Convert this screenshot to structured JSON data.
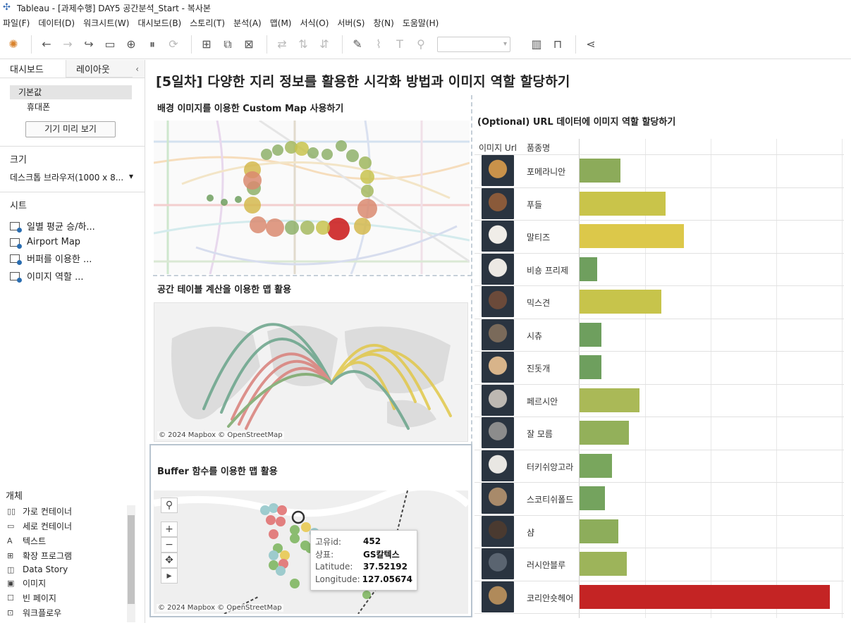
{
  "window": {
    "title": "Tableau - [과제수행] DAY5 공간분석_Start - 복사본"
  },
  "menu": [
    "파일(F)",
    "데이터(D)",
    "워크시트(W)",
    "대시보드(B)",
    "스토리(T)",
    "분석(A)",
    "맵(M)",
    "서식(O)",
    "서버(S)",
    "창(N)",
    "도움말(H)"
  ],
  "left": {
    "tab_dashboard": "대시보드",
    "tab_layout": "레이아웃",
    "device_default": "기본값",
    "device_phone": "휴대폰",
    "preview_button": "기기 미리 보기",
    "size_title": "크기",
    "size_value": "데스크톱 브라우저(1000 x 8...",
    "sheets_title": "시트",
    "sheets": [
      "일별 평균 승/하...",
      "Airport Map",
      "버퍼를 이용한 ...",
      "이미지 역할 ..."
    ],
    "objects_title": "개체",
    "objects": [
      {
        "icon": "horizontal-container-icon",
        "glyph": "▯▯",
        "label": "가로 컨테이너"
      },
      {
        "icon": "vertical-container-icon",
        "glyph": "▭",
        "label": "세로 컨테이너"
      },
      {
        "icon": "text-icon",
        "glyph": "A",
        "label": "텍스트"
      },
      {
        "icon": "extension-icon",
        "glyph": "⊞",
        "label": "확장 프로그램"
      },
      {
        "icon": "data-story-icon",
        "glyph": "◫",
        "label": "Data Story"
      },
      {
        "icon": "image-icon",
        "glyph": "▣",
        "label": "이미지"
      },
      {
        "icon": "blank-icon",
        "glyph": "☐",
        "label": "빈 페이지"
      },
      {
        "icon": "workflow-icon",
        "glyph": "⊡",
        "label": "워크플로우"
      }
    ]
  },
  "dashboard": {
    "title": "[5일차] 다양한 지리 정보를 활용한 시각화 방법과 이미지 역할 할당하기",
    "zone1_title": "배경 이미지를 이용한 Custom Map 사용하기",
    "zone2_title": "공간 테이블 계산을 이용한 맵 활용",
    "zone3_title": "Buffer 함수를 이용한 맵 활용",
    "zone4_title": "(Optional) URL 데이터에 이미지 역할 할당하기",
    "map_credit": "© 2024 Mapbox © OpenStreetMap",
    "tooltip": [
      {
        "k": "고유id:",
        "v": "452"
      },
      {
        "k": "상표:",
        "v": "GS칼텍스"
      },
      {
        "k": "Latitude:",
        "v": "37.52192"
      },
      {
        "k": "Longitude:",
        "v": "127.05674"
      }
    ]
  },
  "chart_data": {
    "type": "bar",
    "columns": [
      "이미지 Url",
      "품종명"
    ],
    "categories": [
      "포메라니안",
      "푸들",
      "말티즈",
      "비숑 프리제",
      "믹스견",
      "시츄",
      "진돗개",
      "페르시안",
      "잘 모름",
      "터키쉬앙고라",
      "스코티쉬폴드",
      "샴",
      "러시안블루",
      "코리안숏헤어"
    ],
    "values": [
      58,
      121,
      147,
      25,
      115,
      31,
      31,
      85,
      70,
      46,
      36,
      55,
      67,
      353
    ],
    "colors": [
      "#8cab5a",
      "#c9c44a",
      "#dcc84a",
      "#6f9f5e",
      "#c7c44b",
      "#6e9f5e",
      "#6e9f5e",
      "#aab957",
      "#93b05a",
      "#79a65d",
      "#74a35e",
      "#8dad5b",
      "#9db45a",
      "#c42424"
    ],
    "xlim": [
      0,
      370
    ]
  }
}
